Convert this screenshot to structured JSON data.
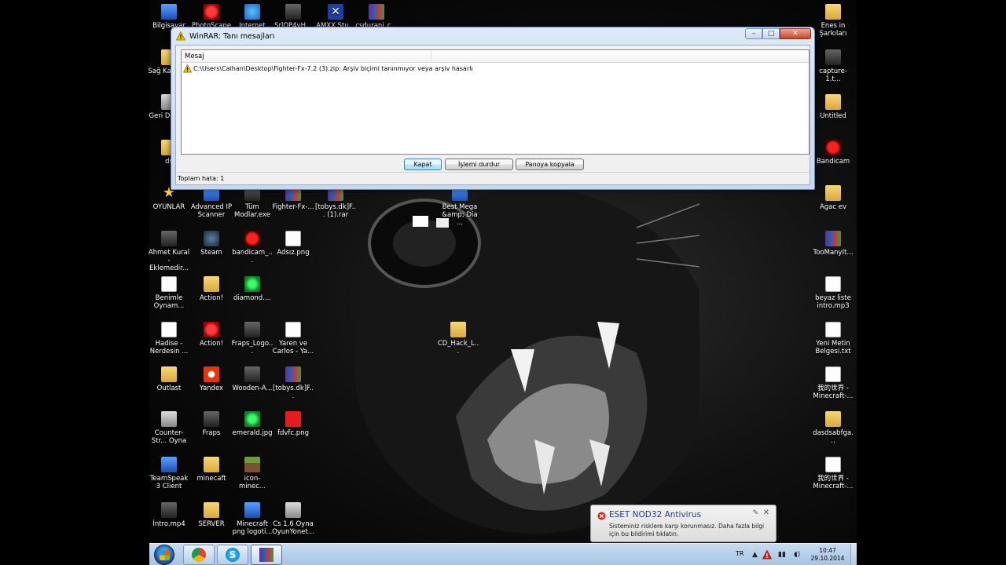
{
  "desktop_icons": [
    {
      "label": "Bilgisayar",
      "icon": "computer-icon"
    },
    {
      "label": "PhotoScape",
      "icon": "photoscape-icon"
    },
    {
      "label": "Internet",
      "icon": "internet-explorer-icon"
    },
    {
      "label": "SrlOP4vH...",
      "icon": "app-icon"
    },
    {
      "label": "AMXX Stu...",
      "icon": "amxx-icon"
    },
    {
      "label": "csdurani_c...",
      "icon": "winrar-archive-icon"
    },
    {
      "label": "Sağ Kajme...",
      "icon": "folder-icon"
    },
    {
      "label": "Geri Dönü...",
      "icon": "recycle-bin-icon"
    },
    {
      "label": "ds",
      "icon": "folder-icon"
    },
    {
      "label": "OYUNLAR",
      "icon": "star-icon"
    },
    {
      "label": "Advanced IP Scanner",
      "icon": "ip-scanner-icon"
    },
    {
      "label": "Tüm Modlar.exe",
      "icon": "exe-icon"
    },
    {
      "label": "Fighter-Fx-...",
      "icon": "winrar-archive-icon"
    },
    {
      "label": "[tobys.dk]F... (1).rar",
      "icon": "winrar-archive-icon"
    },
    {
      "label": "Best Mega &amp; Dia ...",
      "icon": "image-file-icon"
    },
    {
      "label": "Ahmet Kural - Eklemedir...",
      "icon": "video-file-icon"
    },
    {
      "label": "Steam",
      "icon": "steam-icon"
    },
    {
      "label": "bandicam_...",
      "icon": "bandicam-icon"
    },
    {
      "label": "Adsız.png",
      "icon": "png-file-icon"
    },
    {
      "label": "Benimle Oynam...",
      "icon": "music-file-icon"
    },
    {
      "label": "Action!",
      "icon": "folder-icon"
    },
    {
      "label": "diamond....",
      "icon": "diamond-icon"
    },
    {
      "label": "Hadise - Nerdesin ...",
      "icon": "music-file-icon"
    },
    {
      "label": "Action!",
      "icon": "action-record-icon"
    },
    {
      "label": "Fraps_Logo...",
      "icon": "fraps-logo-icon"
    },
    {
      "label": "Yaren ve Carlos - Ya...",
      "icon": "music-file-icon"
    },
    {
      "label": "Outlast",
      "icon": "folder-icon"
    },
    {
      "label": "Yandex",
      "icon": "yandex-icon"
    },
    {
      "label": "Wooden-A...",
      "icon": "wooden-axe-icon"
    },
    {
      "label": "[tobys.dk]F...",
      "icon": "winrar-archive-icon"
    },
    {
      "label": "Counter-Str... Oyna",
      "icon": "counter-strike-icon"
    },
    {
      "label": "Fraps",
      "icon": "fraps-icon"
    },
    {
      "label": "emerald.jpg",
      "icon": "emerald-icon"
    },
    {
      "label": "fdvfc.png",
      "icon": "red-square-icon"
    },
    {
      "label": "TeamSpeak 3 Client",
      "icon": "teamspeak-icon"
    },
    {
      "label": "minecaft",
      "icon": "folder-icon"
    },
    {
      "label": "icon-minec...",
      "icon": "minecraft-block-icon"
    },
    {
      "label": "İntro.mp4",
      "icon": "video-file-icon"
    },
    {
      "label": "SERVER",
      "icon": "folder-icon"
    },
    {
      "label": "Minecraft png logoti...",
      "icon": "image-file-icon"
    },
    {
      "label": "Cs 1.6 Oyna OyunYonet...",
      "icon": "counter-strike-icon"
    },
    {
      "label": "CD_Hack_L...",
      "icon": "folder-icon"
    },
    {
      "label": "Enes in Şarkıları",
      "icon": "folder-icon"
    },
    {
      "label": "capture-1.t...",
      "icon": "video-file-icon"
    },
    {
      "label": "Untitled",
      "icon": "folder-icon"
    },
    {
      "label": "Bandicam",
      "icon": "bandicam-icon"
    },
    {
      "label": "Agac ev",
      "icon": "folder-icon"
    },
    {
      "label": "TooManyIt...",
      "icon": "winrar-archive-icon"
    },
    {
      "label": "beyaz liste intro.mp3",
      "icon": "music-file-icon"
    },
    {
      "label": "Yeni Metin Belgesi.txt",
      "icon": "text-file-icon"
    },
    {
      "label": "我的世界 -Minecraft-...",
      "icon": "text-file-icon"
    },
    {
      "label": "dasdsabfga...",
      "icon": "folder-icon"
    },
    {
      "label": "我的世界 -Minecraft-...",
      "icon": "text-file-icon"
    }
  ],
  "winrar_dialog": {
    "title": "WinRAR: Tanı mesajları",
    "column_header": "Mesaj",
    "messages": [
      "C:\\Users\\Calhan\\Desktop\\Fighter-Fx-7.2 (3).zip: Arşiv biçimi tanınmıyor veya arşiv hasarlı"
    ],
    "buttons": {
      "close": "Kapat",
      "stop": "İşlemi durdur",
      "copy": "Panoya kopyala"
    },
    "status": "Toplam hata: 1"
  },
  "notification": {
    "title": "ESET NOD32 Antivirus",
    "text": "Sisteminiz risklere karşı korunmasız. Daha fazla bilgi için bu bildirimi tıklatın."
  },
  "taskbar": {
    "language": "TR",
    "time": "10:47",
    "date": "29.10.2014",
    "pinned": [
      "chrome-icon",
      "skype-icon",
      "winrar-icon"
    ]
  },
  "colors": {
    "taskbar": "#b7d0ea",
    "window_frame": "#c7d9ee",
    "notification_title": "#1a3d8f"
  }
}
